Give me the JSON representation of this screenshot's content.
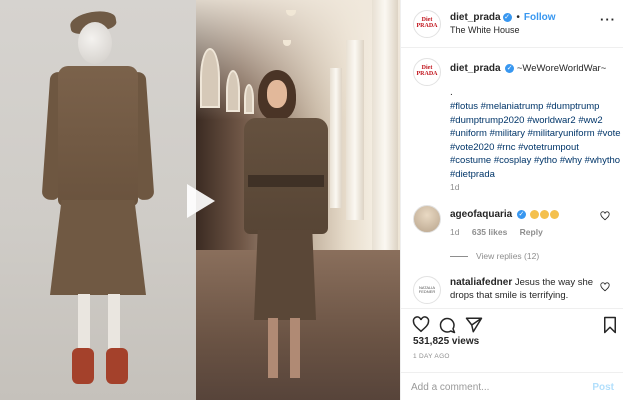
{
  "header": {
    "username": "diet_prada",
    "follow_label": "Follow",
    "location": "The White House",
    "avatar_text": "Diet PRADA"
  },
  "caption": {
    "username": "diet_prada",
    "text": "~WeWoreWorldWar~",
    "dot": ".",
    "hashtags": "#flotus #melaniatrump #dumptrump #dumptrump2020 #worldwar2 #ww2 #uniform #military #militaryuniform #vote #vote2020 #rnc #votetrumpout #costume #cosplay #ytho #why #whytho #dietprada",
    "time": "1d"
  },
  "comments": [
    {
      "username": "ageofaquaria",
      "time": "1d",
      "likes": "635 likes",
      "reply": "Reply",
      "view_replies": "View replies (12)"
    },
    {
      "username": "nataliafedner",
      "text": "Jesus the way she drops that smile is terrifying.",
      "avatar_text": "NATALIA FEDNER"
    }
  ],
  "stats": {
    "views": "531,825 views",
    "ago": "1 DAY AGO"
  },
  "add_comment": {
    "placeholder": "Add a comment...",
    "post_label": "Post"
  },
  "colors": {
    "link": "#3897f0",
    "hashtag": "#003569",
    "brand_red": "#c0121a"
  }
}
